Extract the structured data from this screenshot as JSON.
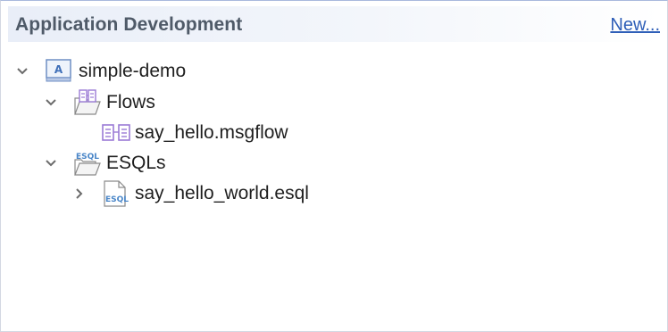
{
  "header": {
    "title": "Application Development",
    "new_link": "New..."
  },
  "tree": {
    "items": [
      {
        "label": "simple-demo",
        "icon": "application-icon",
        "expanded": true
      },
      {
        "label": "Flows",
        "icon": "flows-folder-icon",
        "expanded": true
      },
      {
        "label": "say_hello.msgflow",
        "icon": "msgflow-icon"
      },
      {
        "label": "ESQLs",
        "icon": "esql-folder-icon",
        "expanded": true
      },
      {
        "label": "say_hello_world.esql",
        "icon": "esql-file-icon",
        "expanded": false
      }
    ]
  },
  "colors": {
    "accent_link": "#2f5fb8",
    "header_text": "#4f5a68",
    "flow_icon": "#9b7bd6",
    "esql_icon": "#4a86c8"
  }
}
